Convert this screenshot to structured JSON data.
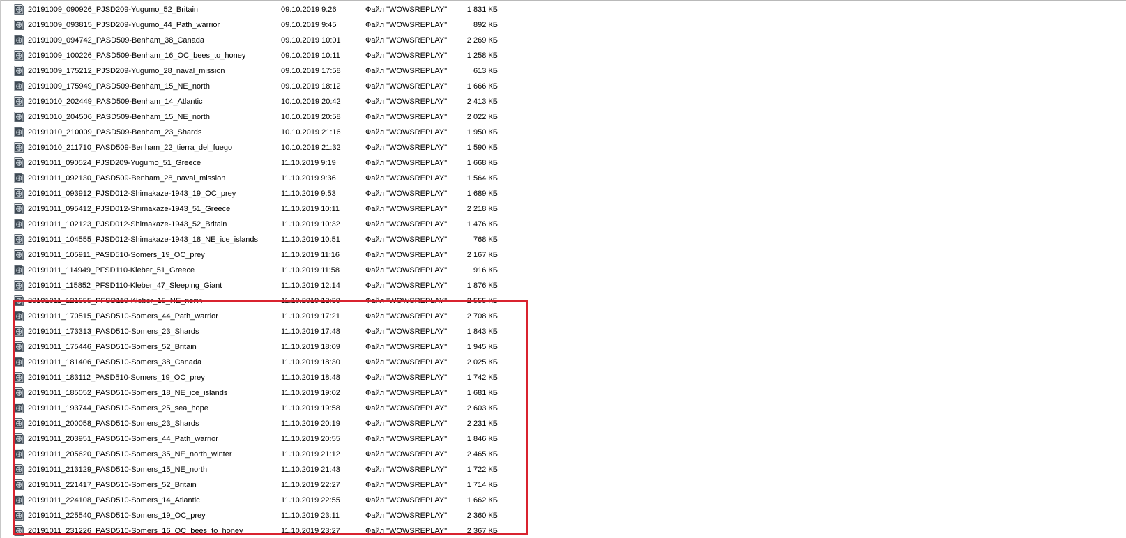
{
  "accent_color": "#d9232f",
  "icon_name": "wowsreplay-file-icon",
  "files": [
    {
      "name": "20191009_090926_PJSD209-Yugumo_52_Britain",
      "date": "09.10.2019 9:26",
      "type": "Файл \"WOWSREPLAY\"",
      "size": "1 831 КБ"
    },
    {
      "name": "20191009_093815_PJSD209-Yugumo_44_Path_warrior",
      "date": "09.10.2019 9:45",
      "type": "Файл \"WOWSREPLAY\"",
      "size": "892 КБ"
    },
    {
      "name": "20191009_094742_PASD509-Benham_38_Canada",
      "date": "09.10.2019 10:01",
      "type": "Файл \"WOWSREPLAY\"",
      "size": "2 269 КБ"
    },
    {
      "name": "20191009_100226_PASD509-Benham_16_OC_bees_to_honey",
      "date": "09.10.2019 10:11",
      "type": "Файл \"WOWSREPLAY\"",
      "size": "1 258 КБ"
    },
    {
      "name": "20191009_175212_PJSD209-Yugumo_28_naval_mission",
      "date": "09.10.2019 17:58",
      "type": "Файл \"WOWSREPLAY\"",
      "size": "613 КБ"
    },
    {
      "name": "20191009_175949_PASD509-Benham_15_NE_north",
      "date": "09.10.2019 18:12",
      "type": "Файл \"WOWSREPLAY\"",
      "size": "1 666 КБ"
    },
    {
      "name": "20191010_202449_PASD509-Benham_14_Atlantic",
      "date": "10.10.2019 20:42",
      "type": "Файл \"WOWSREPLAY\"",
      "size": "2 413 КБ"
    },
    {
      "name": "20191010_204506_PASD509-Benham_15_NE_north",
      "date": "10.10.2019 20:58",
      "type": "Файл \"WOWSREPLAY\"",
      "size": "2 022 КБ"
    },
    {
      "name": "20191010_210009_PASD509-Benham_23_Shards",
      "date": "10.10.2019 21:16",
      "type": "Файл \"WOWSREPLAY\"",
      "size": "1 950 КБ"
    },
    {
      "name": "20191010_211710_PASD509-Benham_22_tierra_del_fuego",
      "date": "10.10.2019 21:32",
      "type": "Файл \"WOWSREPLAY\"",
      "size": "1 590 КБ"
    },
    {
      "name": "20191011_090524_PJSD209-Yugumo_51_Greece",
      "date": "11.10.2019 9:19",
      "type": "Файл \"WOWSREPLAY\"",
      "size": "1 668 КБ"
    },
    {
      "name": "20191011_092130_PASD509-Benham_28_naval_mission",
      "date": "11.10.2019 9:36",
      "type": "Файл \"WOWSREPLAY\"",
      "size": "1 564 КБ"
    },
    {
      "name": "20191011_093912_PJSD012-Shimakaze-1943_19_OC_prey",
      "date": "11.10.2019 9:53",
      "type": "Файл \"WOWSREPLAY\"",
      "size": "1 689 КБ"
    },
    {
      "name": "20191011_095412_PJSD012-Shimakaze-1943_51_Greece",
      "date": "11.10.2019 10:11",
      "type": "Файл \"WOWSREPLAY\"",
      "size": "2 218 КБ"
    },
    {
      "name": "20191011_102123_PJSD012-Shimakaze-1943_52_Britain",
      "date": "11.10.2019 10:32",
      "type": "Файл \"WOWSREPLAY\"",
      "size": "1 476 КБ"
    },
    {
      "name": "20191011_104555_PJSD012-Shimakaze-1943_18_NE_ice_islands",
      "date": "11.10.2019 10:51",
      "type": "Файл \"WOWSREPLAY\"",
      "size": "768 КБ"
    },
    {
      "name": "20191011_105911_PASD510-Somers_19_OC_prey",
      "date": "11.10.2019 11:16",
      "type": "Файл \"WOWSREPLAY\"",
      "size": "2 167 КБ"
    },
    {
      "name": "20191011_114949_PFSD110-Kleber_51_Greece",
      "date": "11.10.2019 11:58",
      "type": "Файл \"WOWSREPLAY\"",
      "size": "916 КБ"
    },
    {
      "name": "20191011_115852_PFSD110-Kleber_47_Sleeping_Giant",
      "date": "11.10.2019 12:14",
      "type": "Файл \"WOWSREPLAY\"",
      "size": "1 876 КБ"
    },
    {
      "name": "20191011_121655_PFSD110-Kleber_15_NE_north",
      "date": "11.10.2019 12:30",
      "type": "Файл \"WOWSREPLAY\"",
      "size": "2 555 КБ"
    },
    {
      "name": "20191011_170515_PASD510-Somers_44_Path_warrior",
      "date": "11.10.2019 17:21",
      "type": "Файл \"WOWSREPLAY\"",
      "size": "2 708 КБ"
    },
    {
      "name": "20191011_173313_PASD510-Somers_23_Shards",
      "date": "11.10.2019 17:48",
      "type": "Файл \"WOWSREPLAY\"",
      "size": "1 843 КБ"
    },
    {
      "name": "20191011_175446_PASD510-Somers_52_Britain",
      "date": "11.10.2019 18:09",
      "type": "Файл \"WOWSREPLAY\"",
      "size": "1 945 КБ"
    },
    {
      "name": "20191011_181406_PASD510-Somers_38_Canada",
      "date": "11.10.2019 18:30",
      "type": "Файл \"WOWSREPLAY\"",
      "size": "2 025 КБ"
    },
    {
      "name": "20191011_183112_PASD510-Somers_19_OC_prey",
      "date": "11.10.2019 18:48",
      "type": "Файл \"WOWSREPLAY\"",
      "size": "1 742 КБ"
    },
    {
      "name": "20191011_185052_PASD510-Somers_18_NE_ice_islands",
      "date": "11.10.2019 19:02",
      "type": "Файл \"WOWSREPLAY\"",
      "size": "1 681 КБ"
    },
    {
      "name": "20191011_193744_PASD510-Somers_25_sea_hope",
      "date": "11.10.2019 19:58",
      "type": "Файл \"WOWSREPLAY\"",
      "size": "2 603 КБ"
    },
    {
      "name": "20191011_200058_PASD510-Somers_23_Shards",
      "date": "11.10.2019 20:19",
      "type": "Файл \"WOWSREPLAY\"",
      "size": "2 231 КБ"
    },
    {
      "name": "20191011_203951_PASD510-Somers_44_Path_warrior",
      "date": "11.10.2019 20:55",
      "type": "Файл \"WOWSREPLAY\"",
      "size": "1 846 КБ"
    },
    {
      "name": "20191011_205620_PASD510-Somers_35_NE_north_winter",
      "date": "11.10.2019 21:12",
      "type": "Файл \"WOWSREPLAY\"",
      "size": "2 465 КБ"
    },
    {
      "name": "20191011_213129_PASD510-Somers_15_NE_north",
      "date": "11.10.2019 21:43",
      "type": "Файл \"WOWSREPLAY\"",
      "size": "1 722 КБ"
    },
    {
      "name": "20191011_221417_PASD510-Somers_52_Britain",
      "date": "11.10.2019 22:27",
      "type": "Файл \"WOWSREPLAY\"",
      "size": "1 714 КБ"
    },
    {
      "name": "20191011_224108_PASD510-Somers_14_Atlantic",
      "date": "11.10.2019 22:55",
      "type": "Файл \"WOWSREPLAY\"",
      "size": "1 662 КБ"
    },
    {
      "name": "20191011_225540_PASD510-Somers_19_OC_prey",
      "date": "11.10.2019 23:11",
      "type": "Файл \"WOWSREPLAY\"",
      "size": "2 360 КБ"
    },
    {
      "name": "20191011_231226_PASD510-Somers_16_OC_bees_to_honey",
      "date": "11.10.2019 23:27",
      "type": "Файл \"WOWSREPLAY\"",
      "size": "2 367 КБ"
    }
  ]
}
